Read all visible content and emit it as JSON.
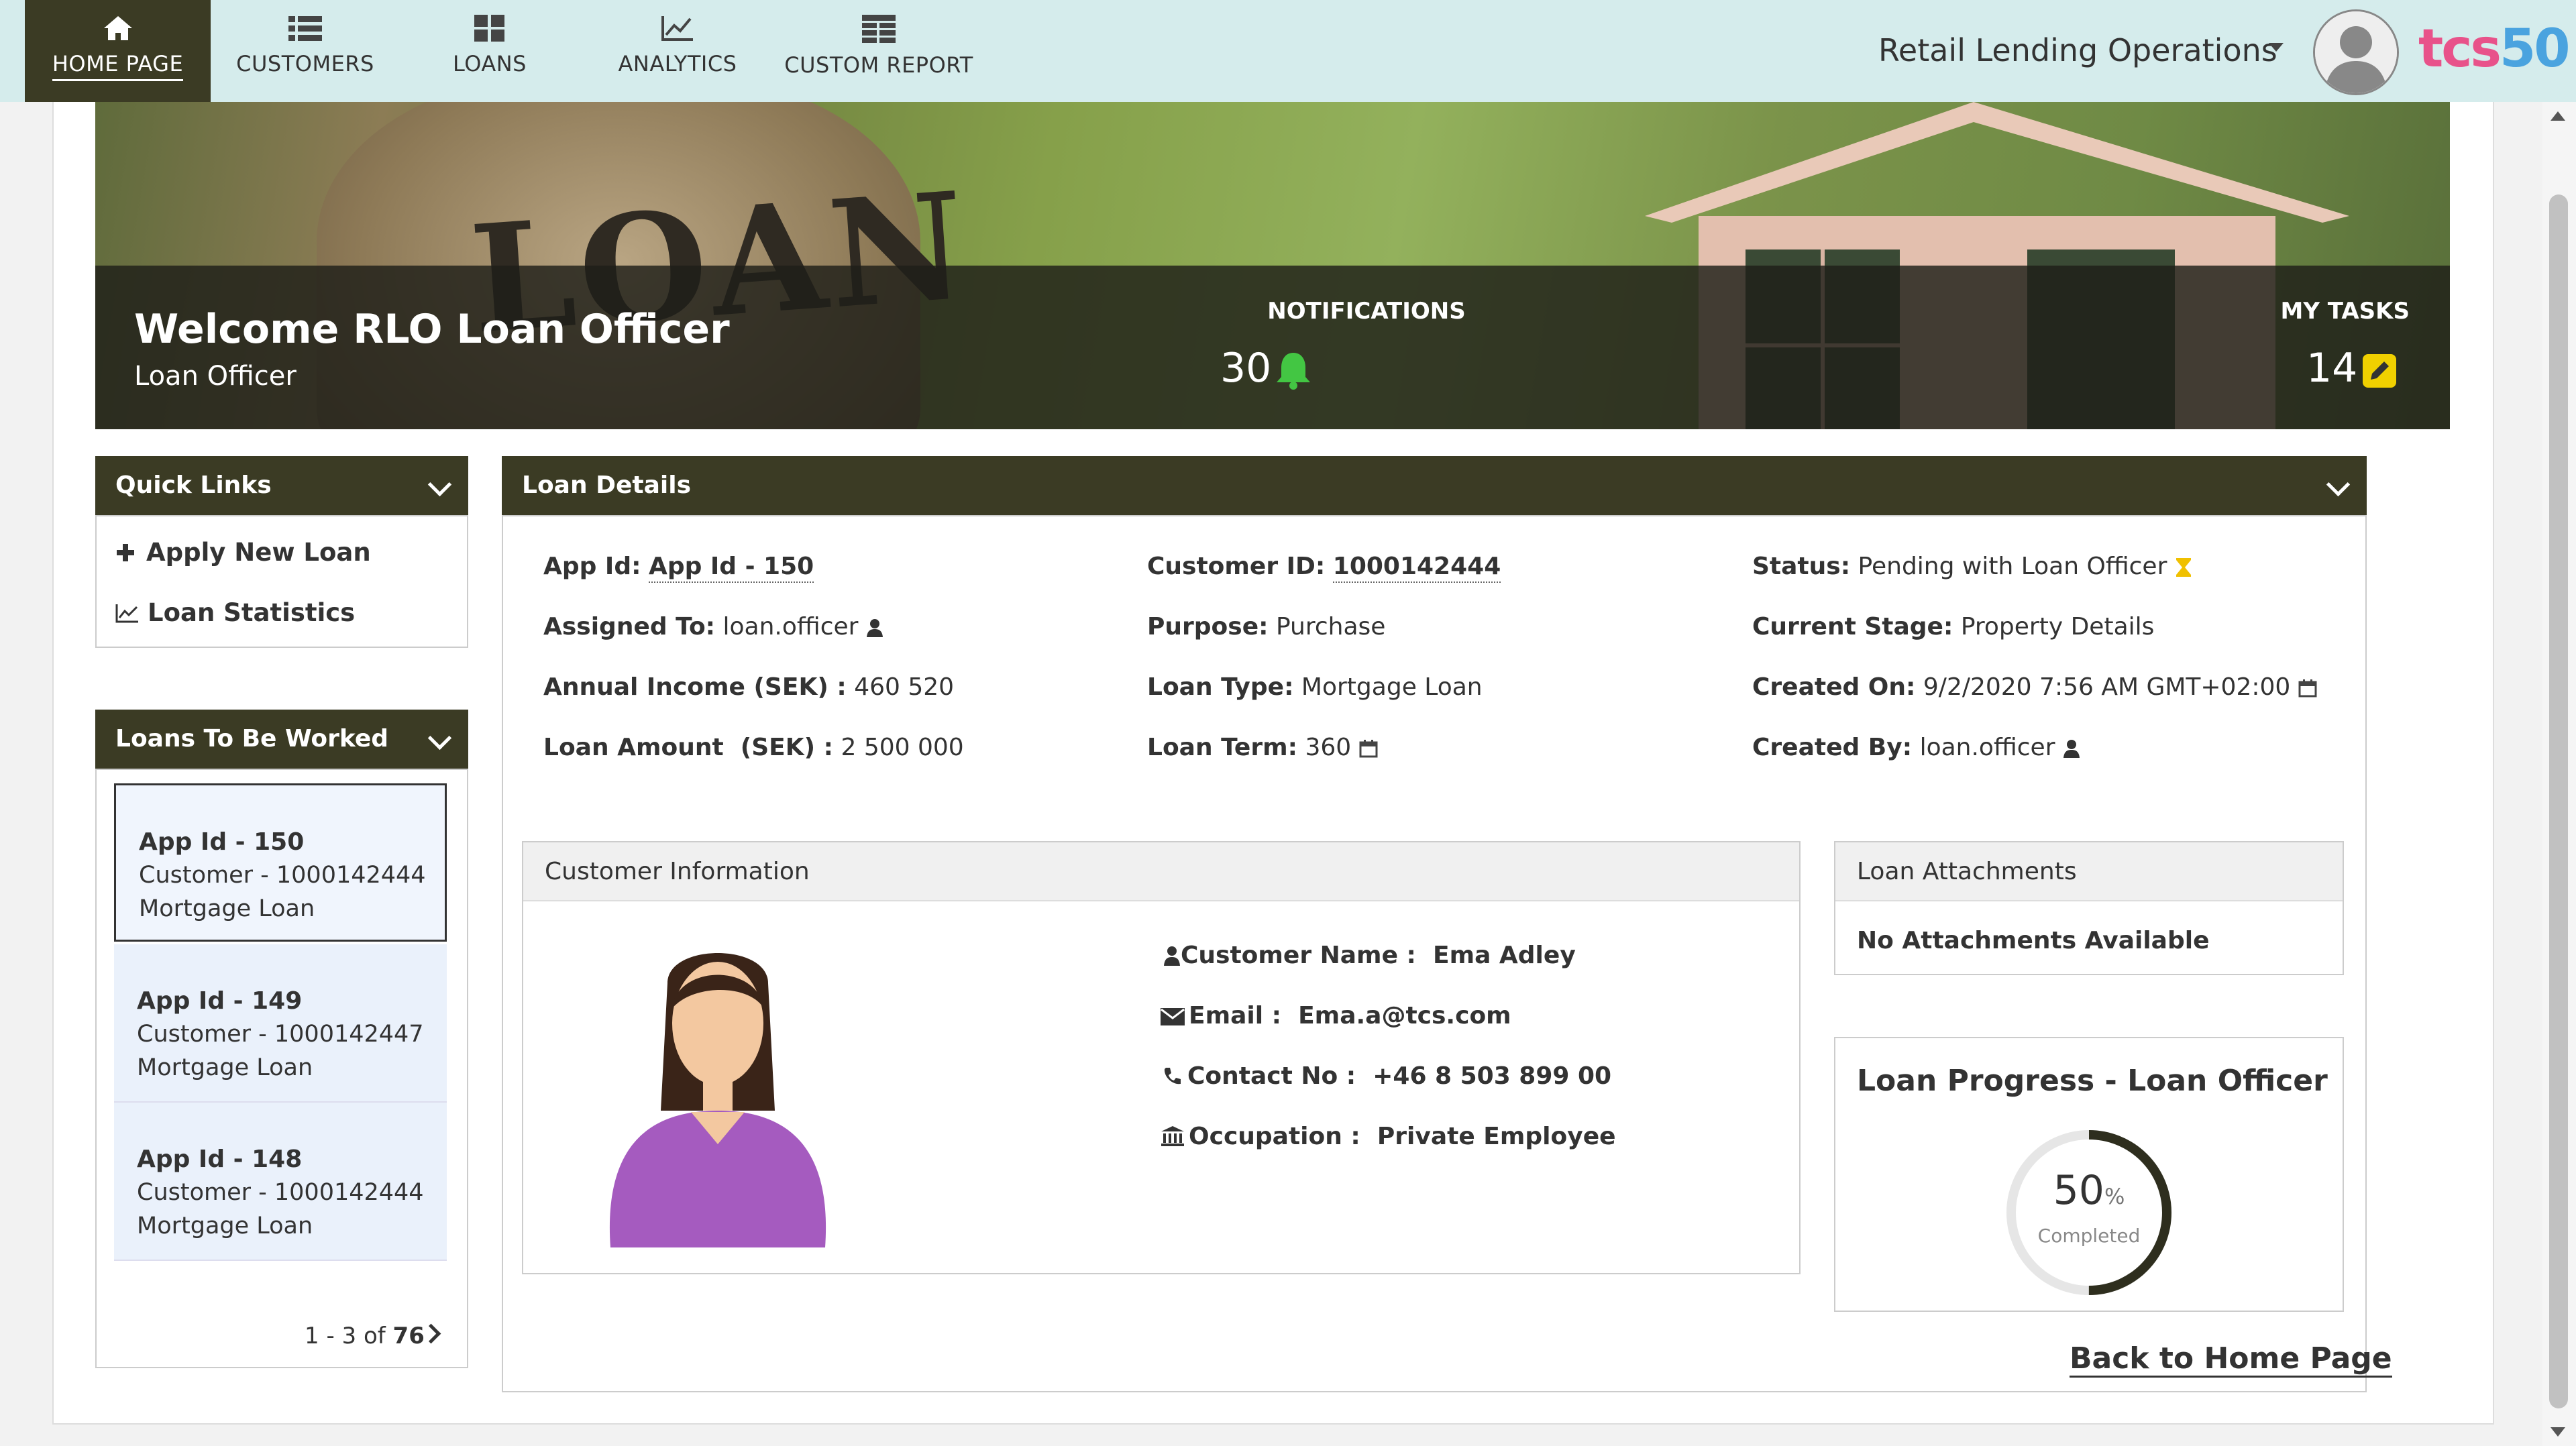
{
  "nav": {
    "tabs": [
      {
        "label": "HOME PAGE",
        "icon": "home-icon"
      },
      {
        "label": "CUSTOMERS",
        "icon": "list-icon"
      },
      {
        "label": "LOANS",
        "icon": "grid-icon"
      },
      {
        "label": "ANALYTICS",
        "icon": "line-chart-icon"
      },
      {
        "label": "CUSTOM REPORT",
        "icon": "table-icon"
      }
    ],
    "org_title": "Retail Lending Operations",
    "logo_a": "tcs",
    "logo_b": "50",
    "colors": {
      "bar": "#d5ecec",
      "active_tab": "#3b3b24",
      "logo_a": "#e8528a",
      "logo_b": "#4aa3df"
    }
  },
  "banner": {
    "banner_word": "LOAN",
    "welcome_title": "Welcome RLO Loan Officer",
    "welcome_role": "Loan Officer",
    "notifications_label": "NOTIFICATIONS",
    "notifications_count": "30",
    "tasks_label": "MY TASKS",
    "tasks_count": "14",
    "colors": {
      "bell": "#43c643",
      "pencil": "#f0d000"
    }
  },
  "quick_links": {
    "title": "Quick Links",
    "items": [
      {
        "label": "Apply New Loan",
        "icon": "plus-icon"
      },
      {
        "label": "Loan Statistics",
        "icon": "chart-icon"
      }
    ]
  },
  "loans_worked": {
    "title": "Loans To Be Worked",
    "items": [
      {
        "app": "App Id - 150",
        "customer": "Customer - 1000142444",
        "product": "Mortgage Loan"
      },
      {
        "app": "App Id - 149",
        "customer": "Customer - 1000142447",
        "product": "Mortgage Loan"
      },
      {
        "app": "App Id - 148",
        "customer": "Customer - 1000142444",
        "product": "Mortgage Loan"
      }
    ],
    "pager_range": "1 - 3 of ",
    "pager_total": "76"
  },
  "loan_details": {
    "title": "Loan Details",
    "app_id_label": "App Id:",
    "app_id_value": "App Id - 150",
    "assigned_label": "Assigned To:",
    "assigned_value": "loan.officer",
    "income_label": "Annual Income (SEK) :",
    "income_value": "460 520",
    "amount_label": "Loan Amount  (SEK) :",
    "amount_value": "2 500 000",
    "customer_id_label": "Customer ID:",
    "customer_id_value": "1000142444",
    "purpose_label": "Purpose:",
    "purpose_value": "Purchase",
    "loan_type_label": "Loan Type:",
    "loan_type_value": "Mortgage Loan",
    "term_label": "Loan Term:",
    "term_value": "360",
    "status_label": "Status:",
    "status_value": "Pending with Loan Officer",
    "stage_label": "Current Stage:",
    "stage_value": "Property Details",
    "created_on_label": "Created On:",
    "created_on_value": "9/2/2020 7:56 AM GMT+02:00",
    "created_by_label": "Created By:",
    "created_by_value": "loan.officer"
  },
  "customer_info": {
    "title": "Customer Information",
    "name_label": "Customer Name :",
    "name_value": "Ema Adley",
    "email_label": "Email :",
    "email_value": "Ema.a@tcs.com",
    "contact_label": "Contact No :",
    "contact_value": "+46 8 503 899 00",
    "occupation_label": "Occupation :",
    "occupation_value": "Private Employee"
  },
  "attachments": {
    "title": "Loan Attachments",
    "empty_text": "No Attachments Available"
  },
  "progress": {
    "title": "Loan Progress - Loan Officer",
    "percent": "50",
    "percent_sign": "%",
    "caption": "Completed",
    "fraction": 0.5
  },
  "back_link": "Back to Home Page"
}
